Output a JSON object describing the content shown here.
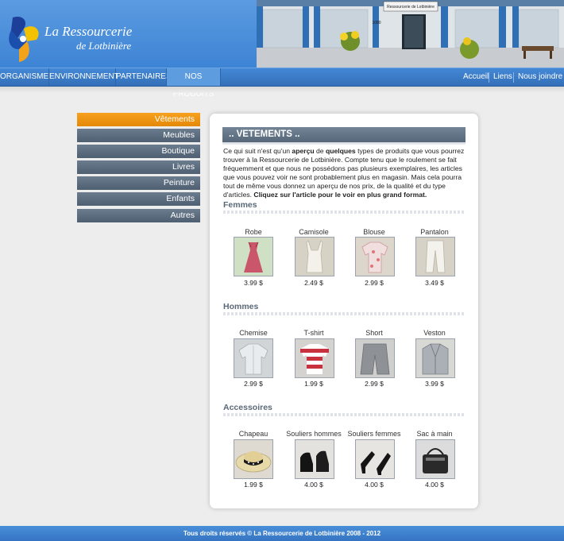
{
  "header": {
    "brand_line1": "La Ressourcerie",
    "brand_line2": "de Lotbinière",
    "storefront_sign": "Ressourcerie de Lotbinière",
    "storefront_number": "1080"
  },
  "nav": {
    "items": [
      {
        "label": "ORGANISME"
      },
      {
        "label": "ENVIRONNEMENT"
      },
      {
        "label": "PARTENAIRES"
      },
      {
        "label": "NOS PRODUITS"
      }
    ],
    "right": [
      {
        "label": "Accueil"
      },
      {
        "label": "Liens"
      },
      {
        "label": "Nous joindre"
      }
    ]
  },
  "sidebar": {
    "items": [
      {
        "label": "Vêtements"
      },
      {
        "label": "Meubles"
      },
      {
        "label": "Boutique"
      },
      {
        "label": "Livres"
      },
      {
        "label": "Peinture"
      },
      {
        "label": "Enfants"
      },
      {
        "label": "Autres"
      }
    ]
  },
  "main": {
    "title": ".. VETEMENTS ..",
    "intro": {
      "p1": "Ce qui suit n'est qu'un ",
      "b1": "aperçu",
      "p2": " de ",
      "b2": "quelques",
      "p3": " types de produits que vous pourrez trouver à la Ressourcerie de Lotbinière. Compte tenu que le roulement se fait fréquemment et que nous ne possédons pas plusieurs exemplaires, les articles que vous pouvez voir ne sont probablement plus en magasin. Mais cela pourra tout de même vous donnez un aperçu de nos prix, de la qualité et du type d'articles. ",
      "b3": "Cliquez sur l'article pour le voir en plus grand format."
    },
    "sections": [
      {
        "title": "Femmes",
        "products": [
          {
            "name": "Robe",
            "price": "3.99 $",
            "icon": "dress-icon"
          },
          {
            "name": "Camisole",
            "price": "2.49 $",
            "icon": "camisole-icon"
          },
          {
            "name": "Blouse",
            "price": "2.99 $",
            "icon": "blouse-icon"
          },
          {
            "name": "Pantalon",
            "price": "3.49 $",
            "icon": "pants-icon"
          }
        ]
      },
      {
        "title": "Hommes",
        "products": [
          {
            "name": "Chemise",
            "price": "2.99 $",
            "icon": "shirt-icon"
          },
          {
            "name": "T-shirt",
            "price": "1.99 $",
            "icon": "tshirt-icon"
          },
          {
            "name": "Short",
            "price": "2.99 $",
            "icon": "shorts-icon"
          },
          {
            "name": "Veston",
            "price": "3.99 $",
            "icon": "jacket-icon"
          }
        ]
      },
      {
        "title": "Accessoires",
        "products": [
          {
            "name": "Chapeau",
            "price": "1.99 $",
            "icon": "hat-icon"
          },
          {
            "name": "Souliers hommes",
            "price": "4.00 $",
            "icon": "mens-shoes-icon"
          },
          {
            "name": "Souliers femmes",
            "price": "4.00 $",
            "icon": "womens-shoes-icon"
          },
          {
            "name": "Sac à main",
            "price": "4.00 $",
            "icon": "handbag-icon"
          }
        ]
      }
    ]
  },
  "footer": {
    "text": "Tous droits réservés © La Ressourcerie de Lotbinière 2008 - 2012"
  },
  "colors": {
    "header_blue": "#3e84d5",
    "sidebar_active": "#f7a11f",
    "sidebar_item": "#56677a",
    "section_title": "#5a6878"
  }
}
